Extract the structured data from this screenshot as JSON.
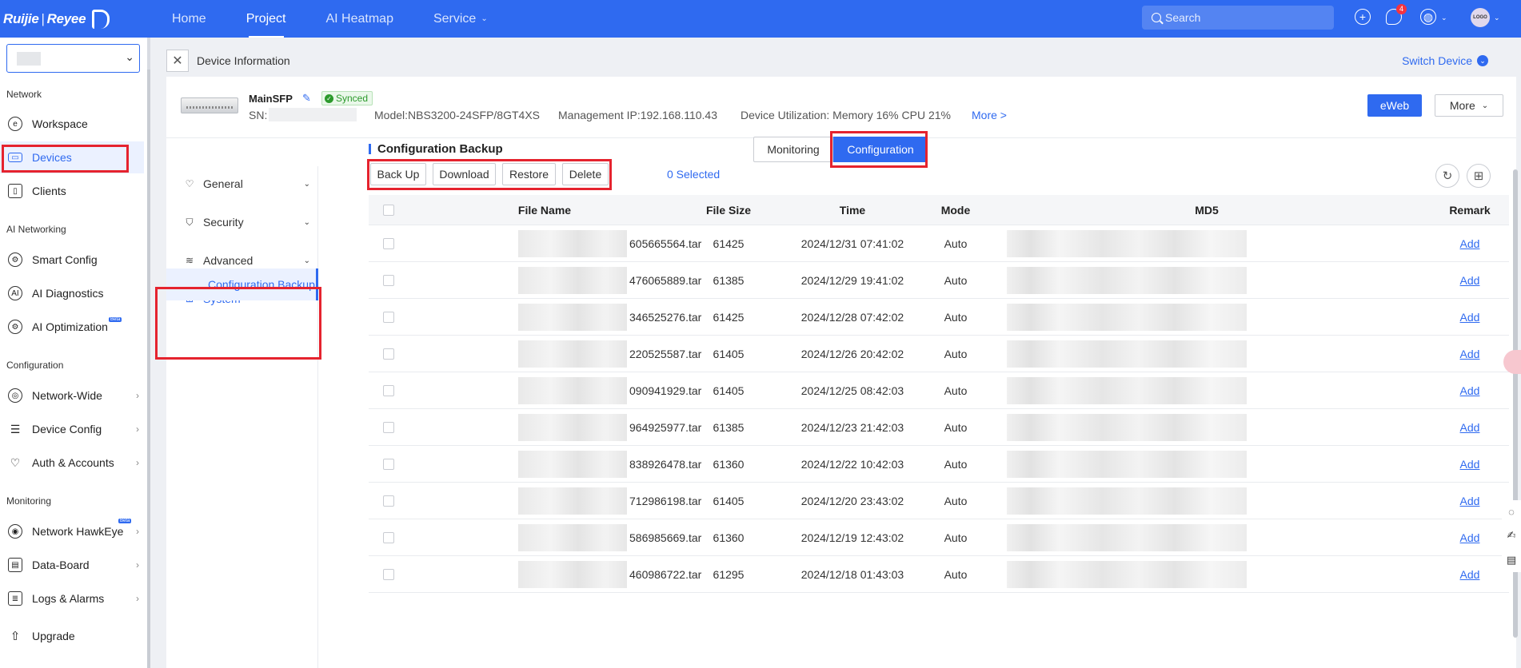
{
  "brand": {
    "name": "Ruijie",
    "product": "Reyee"
  },
  "topnav": {
    "items": [
      {
        "label": "Home",
        "active": false,
        "caret": false
      },
      {
        "label": "Project",
        "active": true,
        "caret": false
      },
      {
        "label": "AI Heatmap",
        "active": false,
        "caret": false
      },
      {
        "label": "Service",
        "active": false,
        "caret": true
      }
    ],
    "search_placeholder": "Search",
    "notification_count": "4",
    "avatar_text": "LOGO"
  },
  "sidebar": {
    "sections": {
      "network": "Network",
      "ai_networking": "AI Networking",
      "configuration": "Configuration",
      "monitoring": "Monitoring"
    },
    "items": {
      "workspace": "Workspace",
      "devices": "Devices",
      "clients": "Clients",
      "smart_config": "Smart Config",
      "ai_diagnostics": "AI Diagnostics",
      "ai_optimization": "AI Optimization",
      "network_wide": "Network-Wide",
      "device_config": "Device Config",
      "auth_accounts": "Auth & Accounts",
      "network_hawkeye": "Network HawkEye",
      "data_board": "Data-Board",
      "logs_alarms": "Logs & Alarms",
      "upgrade": "Upgrade"
    },
    "beta_label": "Beta"
  },
  "header": {
    "title": "Device Information",
    "switch_device": "Switch Device"
  },
  "device": {
    "name": "MainSFP",
    "status": "Synced",
    "sn_label": "SN:",
    "model": "Model:NBS3200-24SFP/8GT4XS",
    "management_ip": "Management IP:192.168.110.43",
    "utilization": "Device Utilization: Memory 16% CPU 21%",
    "more_link": "More >",
    "eweb_button": "eWeb",
    "more_button": "More"
  },
  "view_tabs": {
    "monitoring": "Monitoring",
    "configuration": "Configuration"
  },
  "subnav": {
    "general": "General",
    "security": "Security",
    "advanced": "Advanced",
    "system": "System",
    "configuration_backup": "Configuration Backup"
  },
  "backup": {
    "title": "Configuration Backup",
    "buttons": {
      "back_up": "Back Up",
      "download": "Download",
      "restore": "Restore",
      "delete": "Delete"
    },
    "selected": "0 Selected",
    "columns": {
      "file_name": "File Name",
      "file_size": "File Size",
      "time": "Time",
      "mode": "Mode",
      "md5": "MD5",
      "remark": "Remark"
    },
    "rows": [
      {
        "file_name": "605665564.tar",
        "size": "61425",
        "time": "2024/12/31 07:41:02",
        "mode": "Auto",
        "remark": "Add"
      },
      {
        "file_name": "476065889.tar",
        "size": "61385",
        "time": "2024/12/29 19:41:02",
        "mode": "Auto",
        "remark": "Add"
      },
      {
        "file_name": "346525276.tar",
        "size": "61425",
        "time": "2024/12/28 07:42:02",
        "mode": "Auto",
        "remark": "Add"
      },
      {
        "file_name": "220525587.tar",
        "size": "61405",
        "time": "2024/12/26 20:42:02",
        "mode": "Auto",
        "remark": "Add"
      },
      {
        "file_name": "090941929.tar",
        "size": "61405",
        "time": "2024/12/25 08:42:03",
        "mode": "Auto",
        "remark": "Add"
      },
      {
        "file_name": "964925977.tar",
        "size": "61385",
        "time": "2024/12/23 21:42:03",
        "mode": "Auto",
        "remark": "Add"
      },
      {
        "file_name": "838926478.tar",
        "size": "61360",
        "time": "2024/12/22 10:42:03",
        "mode": "Auto",
        "remark": "Add"
      },
      {
        "file_name": "712986198.tar",
        "size": "61405",
        "time": "2024/12/20 23:43:02",
        "mode": "Auto",
        "remark": "Add"
      },
      {
        "file_name": "586985669.tar",
        "size": "61360",
        "time": "2024/12/19 12:43:02",
        "mode": "Auto",
        "remark": "Add"
      },
      {
        "file_name": "460986722.tar",
        "size": "61295",
        "time": "2024/12/18 01:43:03",
        "mode": "Auto",
        "remark": "Add"
      }
    ]
  },
  "colors": {
    "primary": "#2f6af0",
    "highlight_box": "#e5232e",
    "synced_green": "#2c9a2c"
  }
}
